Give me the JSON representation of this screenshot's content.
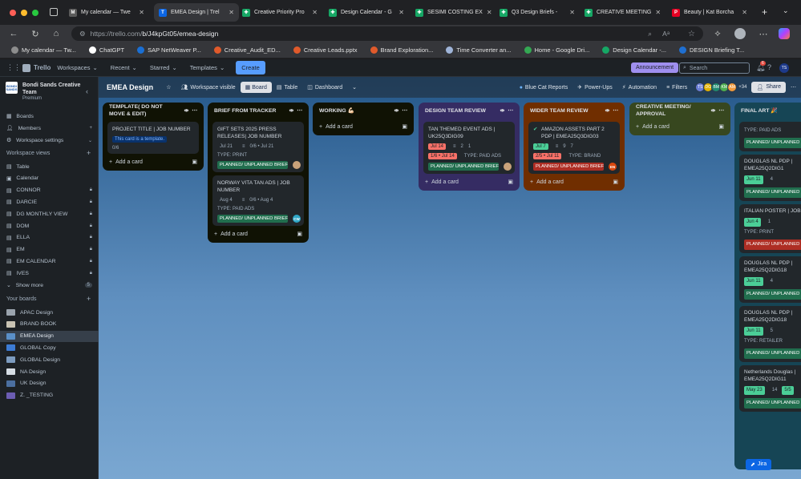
{
  "browser": {
    "tabs": [
      {
        "title": "My calendar — Twe",
        "fav": "M",
        "color": "#5b5b5b"
      },
      {
        "title": "EMEA Design | Trel",
        "fav": "T",
        "color": "#0c66e4",
        "active": true
      },
      {
        "title": "Creative Priority Pro",
        "fav": "✚",
        "color": "#16a765"
      },
      {
        "title": "Design Calendar - G",
        "fav": "✚",
        "color": "#16a765"
      },
      {
        "title": "SESIMI COSTING EX",
        "fav": "✚",
        "color": "#16a765"
      },
      {
        "title": "Q3 Design Briefs -",
        "fav": "✚",
        "color": "#16a765"
      },
      {
        "title": "CREATIVE MEETING",
        "fav": "✚",
        "color": "#16a765"
      },
      {
        "title": "Beauty | Kat Borcha",
        "fav": "P",
        "color": "#e60023"
      }
    ],
    "new_tab": "+",
    "url_domain": "https://trello.com/",
    "url_path": "b/J4kpGt05/emea-design"
  },
  "bookmarks": [
    {
      "label": "My calendar — Tw...",
      "color": "#8d8d8d"
    },
    {
      "label": "ChatGPT",
      "color": "#ffffff"
    },
    {
      "label": "SAP NetWeaver P...",
      "color": "#1a6fd4"
    },
    {
      "label": "Creative_Audit_ED...",
      "color": "#e05a2b"
    },
    {
      "label": "Creative Leads.pptx",
      "color": "#e05a2b"
    },
    {
      "label": "Brand Exploration...",
      "color": "#e05a2b"
    },
    {
      "label": "Time Converter an...",
      "color": "#9fb4d8"
    },
    {
      "label": "Home - Google Dri...",
      "color": "#34a853"
    },
    {
      "label": "Design Calendar -...",
      "color": "#16a765"
    },
    {
      "label": "DESIGN Briefing T...",
      "color": "#1f6fd1"
    }
  ],
  "trello": {
    "app_name": "Trello",
    "menus": [
      "Workspaces",
      "Recent",
      "Starred",
      "Templates"
    ],
    "create_label": "Create",
    "announcement": "Announcement",
    "search_placeholder": "Search",
    "notifications": "6",
    "user_initials": "TS"
  },
  "sidebar": {
    "team_name": "Bondi Sands Creative Team",
    "plan": "Premium",
    "logo_text": "BONDI SANDS",
    "nav": [
      {
        "label": "Boards"
      },
      {
        "label": "Members"
      },
      {
        "label": "Workspace settings"
      }
    ],
    "views_title": "Workspace views",
    "views": [
      "Table",
      "Calendar",
      "CONNOR",
      "DARCIE",
      "DG MONTHLY VIEW",
      "DOM",
      "ELLA",
      "EM",
      "EM CALENDAR",
      "IVES"
    ],
    "show_more": "Show more",
    "show_more_count": "5",
    "boards_title": "Your boards",
    "boards": [
      {
        "label": "APAC Design",
        "color": "#9aa3ad"
      },
      {
        "label": "BRAND BOOK",
        "color": "#c9c3b3"
      },
      {
        "label": "EMEA Design",
        "color": "#5a8fc7"
      },
      {
        "label": "GLOBAL Copy",
        "color": "#3c7bd4"
      },
      {
        "label": "GLOBAL Design",
        "color": "#7d9cc0"
      },
      {
        "label": "NA Design",
        "color": "#d6dde4"
      },
      {
        "label": "UK Design",
        "color": "#4b6fa0"
      },
      {
        "label": "Z. _TESTING",
        "color": "#6c5db3"
      }
    ]
  },
  "board": {
    "title": "EMEA Design",
    "visibility": "Workspace visible",
    "views": [
      "Board",
      "Table",
      "Dashboard"
    ],
    "powerups": [
      "Blue Cat Reports",
      "Power-Ups",
      "Automation",
      "Filters"
    ],
    "member_avatars": [
      {
        "initials": "TS",
        "color": "#6b7fd7"
      },
      {
        "initials": "DG",
        "color": "#e2b203"
      },
      {
        "initials": "BM",
        "color": "#1f8a70"
      },
      {
        "initials": "KM",
        "color": "#4caf50"
      },
      {
        "initials": "AM",
        "color": "#f29a3c"
      }
    ],
    "extra_members": "+34",
    "share": "Share",
    "add_card": "Add a card",
    "lists": [
      {
        "title": "TEMPLATE( DO NOT MOVE & EDIT)",
        "bg": "#101204",
        "cards": [
          {
            "title": "PROJECT TITLE | JOB NUMBER",
            "template_badge": "This card is a template.",
            "checklist": "0/6"
          }
        ]
      },
      {
        "title": "BRIEF FROM TRACKER",
        "bg": "#101204",
        "cards": [
          {
            "title": "GIFT SETS 2025 PRESS RELEASES| JOB NUMBER",
            "date": "Jul 21",
            "checklist": "0/6 • Jul 21",
            "type": "TYPE: PRINT",
            "label": "PLANNED/ UNPLANNED BRIEF: PLA...",
            "avatar": "pic"
          },
          {
            "title": "NORWAY VITA TAN ADS | JOB NUMBER",
            "date": "Aug 4",
            "checklist": "0/6 • Aug 4",
            "type": "TYPE: PAID ADS",
            "label": "PLANNED/ UNPLANNED BRIEF: PLA...",
            "avatar": "CW"
          }
        ]
      },
      {
        "title": "WORKING 💪🏻",
        "bg": "#101204",
        "cards": []
      },
      {
        "title": "DESIGN TEAM REVIEW",
        "bg": "#352c63",
        "cards": [
          {
            "title": "TAN THEMED EVENT ADS | UK25Q3DIG09",
            "date": "Jul 14",
            "comments": "2",
            "attachments": "1",
            "checklist": "1/6 • Jul 14",
            "type": "TYPE: PAID ADS",
            "label": "PLANNED/ UNPLANNED BRIEF: PLA...",
            "avatar": "pic"
          }
        ]
      },
      {
        "title": "WIDER TEAM REVIEW",
        "bg": "#702e00",
        "cards": [
          {
            "title": "AMAZON ASSETS PART 2 PDP | EMEA25Q3DIG03",
            "date": "Jul 7",
            "comments": "9",
            "attachments": "7",
            "checklist": "2/5 • Jul 11",
            "type": "TYPE: BRAND",
            "label": "PLANNED/ UNPLANNED BRIEF: UNP...",
            "avatar": "EN"
          }
        ]
      },
      {
        "title": "CREATIVE MEETING/ APPROVAL",
        "bg": "#37471f",
        "cards": []
      },
      {
        "title": "FINAL ART 🎉",
        "bg": "#164555",
        "cards": [
          {
            "type": "TYPE: PAID ADS",
            "label": "PLANNED/ UNPLANNED"
          },
          {
            "title": "DOUGLAS NL PDP | EMEA25Q2DIG1",
            "date": "Jun 11",
            "comments": "4",
            "label": "PLANNED/ UNPLANNED"
          },
          {
            "title": "ITALIAN POSTER | JOB NUMBER",
            "date": "Jun 4",
            "comments": "1",
            "type": "TYPE: PRINT",
            "label": "PLANNED/ UNPLANNED"
          },
          {
            "title": "DOUGLAS NL PDP | EMEA25Q2DIG18",
            "date": "Jun 11",
            "comments": "4",
            "label": "PLANNED/ UNPLANNED"
          },
          {
            "title": "DOUGLAS NL PDP | EMEA25Q2DIG18",
            "date": "Jun 11",
            "comments": "5",
            "type": "TYPE: RETAILER",
            "label": "PLANNED/ UNPLANNED"
          },
          {
            "title": "Netherlands Douglas | EMEA25Q2DIG11",
            "date": "May 23",
            "comments": "14",
            "checklist": "5/5",
            "label": "PLANNED/ UNPLANNED"
          }
        ]
      }
    ],
    "jira": "Jira"
  }
}
